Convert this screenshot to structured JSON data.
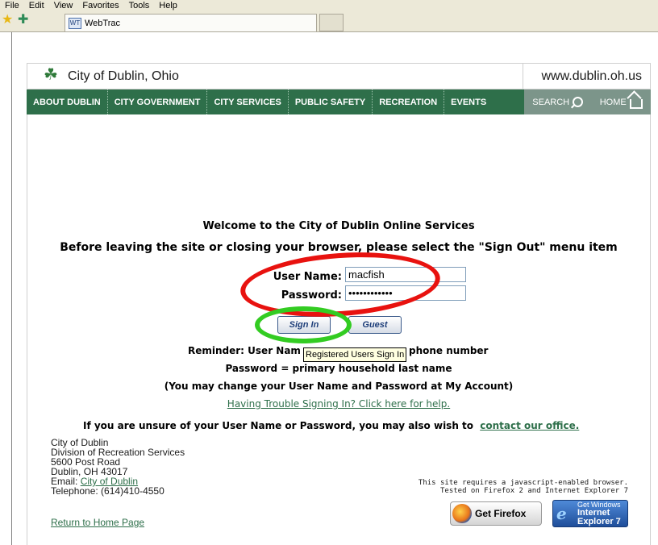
{
  "browser": {
    "menu": [
      "File",
      "Edit",
      "View",
      "Favorites",
      "Tools",
      "Help"
    ],
    "tab_title": "WebTrac",
    "tab_favicon": "WT"
  },
  "header": {
    "site_title": "City of Dublin, Ohio",
    "site_url": "www.dublin.oh.us"
  },
  "nav": {
    "items": [
      "ABOUT DUBLIN",
      "CITY GOVERNMENT",
      "CITY SERVICES",
      "PUBLIC SAFETY",
      "RECREATION",
      "EVENTS"
    ],
    "search_label": "SEARCH",
    "home_label": "HOME"
  },
  "main": {
    "welcome": "Welcome to the City of Dublin Online Services",
    "warning": "Before leaving the site or closing your browser, please select the \"Sign Out\" menu item",
    "username_label": "User Name:",
    "password_label": "Password:",
    "username_value": "macfish",
    "password_value": "••••••••••••",
    "signin_label": "Sign In",
    "guest_label": "Guest",
    "tooltip": "Registered Users Sign In",
    "reminder_part1": "Reminder: User Nam",
    "reminder_part2": "phone number",
    "password_hint": "Password = primary household last name",
    "change_hint": "(You may change your User Name and Password at My Account)",
    "trouble_link": "Having Trouble Signing In? Click here for help.",
    "unsure_text": "If you are unsure of your User Name or Password, you may also wish to",
    "contact_link": "contact our office."
  },
  "footer": {
    "address_lines": [
      "City of Dublin",
      "Division of Recreation Services",
      "5600 Post Road",
      "Dublin, OH 43017"
    ],
    "email_label": "Email:",
    "email_link": "City of Dublin",
    "telephone": "Telephone: (614)410-4550",
    "home_link": "Return to Home Page",
    "js_note_1": "This site requires a javascript-enabled browser.",
    "js_note_2": "Tested on Firefox 2 and Internet Explorer 7",
    "firefox_badge": "Get Firefox",
    "ie_badge_top": "Get Windows",
    "ie_badge_mid": "Internet",
    "ie_badge_bottom": "Explorer 7"
  },
  "annotations": {
    "red_circle_color": "#e8120f",
    "green_circle_color": "#33cc22"
  }
}
